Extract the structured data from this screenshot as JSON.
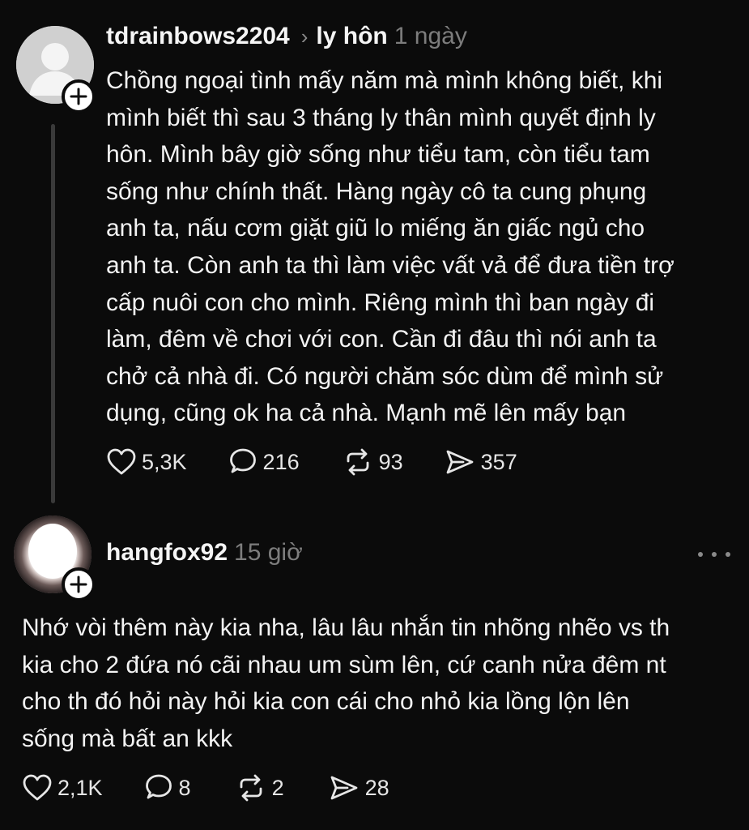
{
  "posts": [
    {
      "username": "tdrainbows2204",
      "chevron": "›",
      "topic": "ly hôn",
      "time": "1 ngày",
      "avatar_icon": "default-avatar-icon",
      "text": "Chồng ngoại tình mấy năm mà mình không biết, khi\nmình biết thì sau 3 tháng ly thân mình quyết định ly\nhôn. Mình bây giờ sống như tiểu tam, còn tiểu tam\nsống như chính thất. Hàng ngày cô ta cung phụng\nanh ta, nấu cơm giặt giũ lo miếng ăn giấc ngủ cho\nanh ta. Còn anh ta thì làm việc vất vả để đưa tiền trợ\ncấp nuôi con cho mình. Riêng mình thì ban ngày đi\nlàm, đêm về chơi với con. Cần đi đâu thì nói anh ta\nchở cả nhà đi. Có người chăm sóc dùm để mình sử\ndụng, cũng ok ha cả nhà. Mạnh mẽ lên mấy bạn",
      "likes": "5,3K",
      "replies": "216",
      "reposts": "93",
      "shares": "357"
    },
    {
      "username": "hangfox92",
      "time": "15 giờ",
      "avatar_icon": "blurred-photo-avatar",
      "text": "Nhớ vòi thêm này kia nha, lâu lâu nhắn tin nhõng nhẽo vs th\nkia cho 2 đứa nó cãi nhau um sùm lên, cứ canh nửa đêm nt\ncho th đó hỏi này hỏi kia con cái cho nhỏ kia lồng lộn lên\nsống mà bất an kkk",
      "likes": "2,1K",
      "replies": "8",
      "reposts": "2",
      "shares": "28"
    }
  ],
  "icons": {
    "like": "heart-icon",
    "reply": "comment-bubble-icon",
    "repost": "repost-arrows-icon",
    "share": "send-icon",
    "follow": "plus-icon",
    "more": "more-dots-icon"
  },
  "colors": {
    "background": "#0b0b0b",
    "text": "#f3f3f3",
    "muted": "#7d7d7d",
    "thread_line": "#3a3a3a"
  }
}
